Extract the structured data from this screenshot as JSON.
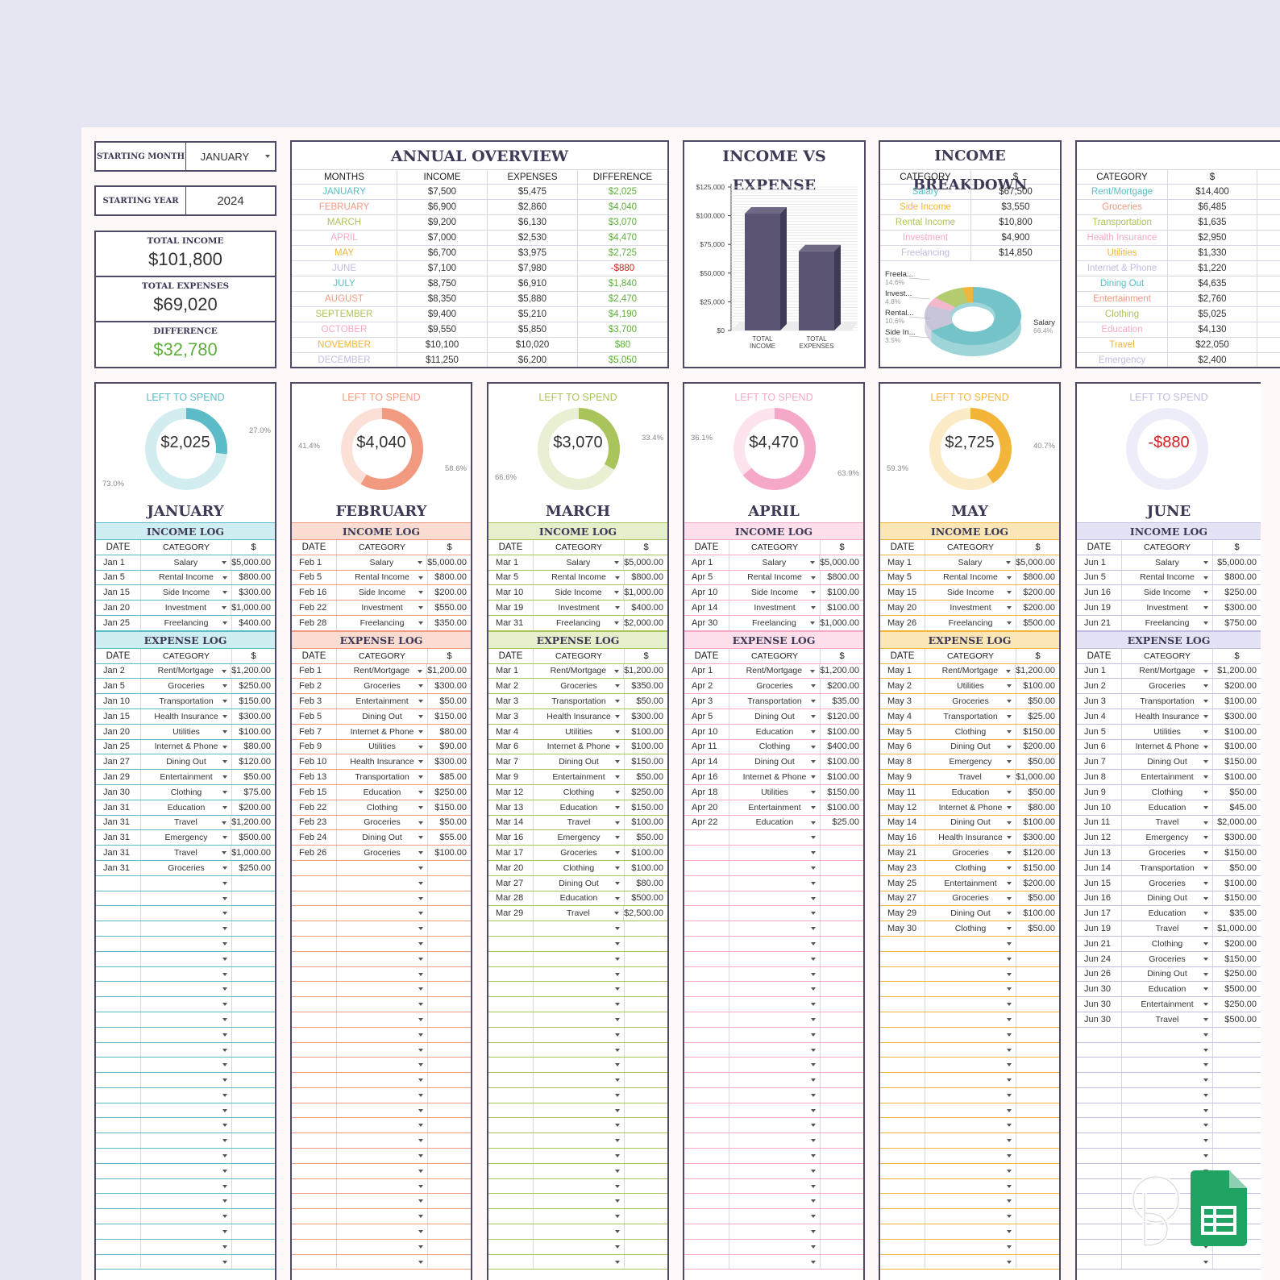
{
  "settings": {
    "starting_month_label": "STARTING MONTH",
    "starting_month_value": "JANUARY",
    "starting_year_label": "STARTING YEAR",
    "starting_year_value": "2024"
  },
  "totals": {
    "income_label": "TOTAL INCOME",
    "income": "$101,800",
    "expenses_label": "TOTAL EXPENSES",
    "expenses": "$69,020",
    "difference_label": "DIFFERENCE",
    "difference": "$32,780"
  },
  "overview": {
    "title": "ANNUAL OVERVIEW",
    "headers": [
      "MONTHS",
      "INCOME",
      "EXPENSES",
      "DIFFERENCE"
    ],
    "rows": [
      {
        "month": "JANUARY",
        "income": "$7,500",
        "expenses": "$5,475",
        "diff": "$2,025",
        "color": "#5bbcc7",
        "neg": false
      },
      {
        "month": "FEBRUARY",
        "income": "$6,900",
        "expenses": "$2,860",
        "diff": "$4,040",
        "color": "#f29a80",
        "neg": false
      },
      {
        "month": "MARCH",
        "income": "$9,200",
        "expenses": "$6,130",
        "diff": "$3,070",
        "color": "#a9c45b",
        "neg": false
      },
      {
        "month": "APRIL",
        "income": "$7,000",
        "expenses": "$2,530",
        "diff": "$4,470",
        "color": "#f5a8c8",
        "neg": false
      },
      {
        "month": "MAY",
        "income": "$6,700",
        "expenses": "$3,975",
        "diff": "$2,725",
        "color": "#f2b53a",
        "neg": false
      },
      {
        "month": "JUNE",
        "income": "$7,100",
        "expenses": "$7,980",
        "diff": "-$880",
        "color": "#c0bde0",
        "neg": true
      },
      {
        "month": "JULY",
        "income": "$8,750",
        "expenses": "$6,910",
        "diff": "$1,840",
        "color": "#5bbcc7",
        "neg": false
      },
      {
        "month": "AUGUST",
        "income": "$8,350",
        "expenses": "$5,880",
        "diff": "$2,470",
        "color": "#f29a80",
        "neg": false
      },
      {
        "month": "SEPTEMBER",
        "income": "$9,400",
        "expenses": "$5,210",
        "diff": "$4,190",
        "color": "#a9c45b",
        "neg": false
      },
      {
        "month": "OCTOBER",
        "income": "$9,550",
        "expenses": "$5,850",
        "diff": "$3,700",
        "color": "#f5a8c8",
        "neg": false
      },
      {
        "month": "NOVEMBER",
        "income": "$10,100",
        "expenses": "$10,020",
        "diff": "$80",
        "color": "#f2b53a",
        "neg": false
      },
      {
        "month": "DECEMBER",
        "income": "$11,250",
        "expenses": "$6,200",
        "diff": "$5,050",
        "color": "#c0bde0",
        "neg": false
      }
    ]
  },
  "chart_data": [
    {
      "type": "bar",
      "title": "INCOME VS EXPENSE",
      "categories": [
        "TOTAL INCOME",
        "TOTAL EXPENSES"
      ],
      "values": [
        101800,
        69020
      ],
      "ylim": [
        0,
        125000
      ],
      "yticks": [
        "$0",
        "$25,000",
        "$50,000",
        "$75,000",
        "$100,000",
        "$125,000"
      ],
      "ytick_values": [
        0,
        25000,
        50000,
        75000,
        100000,
        125000
      ],
      "bar_color": "#5a5472",
      "grid": true
    },
    {
      "type": "pie",
      "title": "INCOME BREAKDOWN",
      "slices": [
        {
          "label": "Salary",
          "value": 66.4,
          "color": "#74c3c9",
          "text": "Salary",
          "pct": "66.4%"
        },
        {
          "label": "Freelancing",
          "value": 14.6,
          "color": "#c8c4d9",
          "text": "Freela...",
          "pct": "14.6%"
        },
        {
          "label": "Investment",
          "value": 4.8,
          "color": "#f4b6cd",
          "text": "Invest...",
          "pct": "4.8%"
        },
        {
          "label": "Rental Income",
          "value": 10.6,
          "color": "#b3cc70",
          "text": "Rental...",
          "pct": "10.6%"
        },
        {
          "label": "Side Income",
          "value": 3.5,
          "color": "#f2b53a",
          "text": "Side In...",
          "pct": "3.5%"
        }
      ]
    }
  ],
  "income_breakdown": {
    "headers": [
      "CATEGORY",
      "$"
    ],
    "rows": [
      {
        "cat": "Salary",
        "val": "$67,500",
        "color": "#5bbcc7"
      },
      {
        "cat": "Side Income",
        "val": "$3,550",
        "color": "#f2b53a"
      },
      {
        "cat": "Rental Income",
        "val": "$10,800",
        "color": "#a9c45b"
      },
      {
        "cat": "Investment",
        "val": "$4,900",
        "color": "#f5a8c8"
      },
      {
        "cat": "Freelancing",
        "val": "$14,850",
        "color": "#c0bde0"
      }
    ]
  },
  "expense_breakdown": {
    "headers": [
      "CATEGORY",
      "$"
    ],
    "rows": [
      {
        "cat": "Rent/Mortgage",
        "val": "$14,400",
        "color": "#5bbcc7"
      },
      {
        "cat": "Groceries",
        "val": "$6,485",
        "color": "#f29a80"
      },
      {
        "cat": "Transportation",
        "val": "$1,635",
        "color": "#a9c45b"
      },
      {
        "cat": "Health Insurance",
        "val": "$2,950",
        "color": "#f5a8c8"
      },
      {
        "cat": "Utilities",
        "val": "$1,330",
        "color": "#f2b53a"
      },
      {
        "cat": "Internet & Phone",
        "val": "$1,220",
        "color": "#c0bde0"
      },
      {
        "cat": "Dining Out",
        "val": "$4,635",
        "color": "#5bbcc7"
      },
      {
        "cat": "Entertainment",
        "val": "$2,760",
        "color": "#f29a80"
      },
      {
        "cat": "Clothing",
        "val": "$5,025",
        "color": "#a9c45b"
      },
      {
        "cat": "Education",
        "val": "$4,130",
        "color": "#f5a8c8"
      },
      {
        "cat": "Travel",
        "val": "$22,050",
        "color": "#f2b53a"
      },
      {
        "cat": "Emergency",
        "val": "$2,400",
        "color": "#c0bde0"
      }
    ]
  },
  "labels": {
    "left_to_spend": "LEFT TO SPEND",
    "income_log": "INCOME LOG",
    "expense_log": "EXPENSE LOG",
    "date": "DATE",
    "category": "CATEGORY",
    "dollar": "$"
  },
  "months": [
    {
      "name": "JANUARY",
      "left": "$2,025",
      "color": "#5bbcc7",
      "light": "#d2edf0",
      "bg": "#cfeef1",
      "ring": "#5bbcc7",
      "spent_frac": 0.73,
      "pct_small": "27.0%",
      "pct_large": "73.0%",
      "neg": false,
      "income": [
        [
          "Jan 1",
          "Salary",
          "$5,000.00"
        ],
        [
          "Jan 5",
          "Rental Income",
          "$800.00"
        ],
        [
          "Jan 15",
          "Side Income",
          "$300.00"
        ],
        [
          "Jan 20",
          "Investment",
          "$1,000.00"
        ],
        [
          "Jan 25",
          "Freelancing",
          "$400.00"
        ]
      ],
      "expenses": [
        [
          "Jan 2",
          "Rent/Mortgage",
          "$1,200.00"
        ],
        [
          "Jan 5",
          "Groceries",
          "$250.00"
        ],
        [
          "Jan 10",
          "Transportation",
          "$150.00"
        ],
        [
          "Jan 15",
          "Health Insurance",
          "$300.00"
        ],
        [
          "Jan 20",
          "Utilities",
          "$100.00"
        ],
        [
          "Jan 25",
          "Internet & Phone",
          "$80.00"
        ],
        [
          "Jan 27",
          "Dining Out",
          "$120.00"
        ],
        [
          "Jan 29",
          "Entertainment",
          "$50.00"
        ],
        [
          "Jan 30",
          "Clothing",
          "$75.00"
        ],
        [
          "Jan 31",
          "Education",
          "$200.00"
        ],
        [
          "Jan 31",
          "Travel",
          "$1,200.00"
        ],
        [
          "Jan 31",
          "Emergency",
          "$500.00"
        ],
        [
          "Jan 31",
          "Travel",
          "$1,000.00"
        ],
        [
          "Jan 31",
          "Groceries",
          "$250.00"
        ]
      ]
    },
    {
      "name": "FEBRUARY",
      "left": "$4,040",
      "color": "#f29a80",
      "light": "#fbe0d8",
      "bg": "#fbdcd3",
      "ring": "#f29a80",
      "spent_frac": 0.414,
      "pct_small": "41.4%",
      "pct_large": "58.6%",
      "neg": false,
      "income": [
        [
          "Feb 1",
          "Salary",
          "$5,000.00"
        ],
        [
          "Feb 5",
          "Rental Income",
          "$800.00"
        ],
        [
          "Feb 16",
          "Side Income",
          "$200.00"
        ],
        [
          "Feb 22",
          "Investment",
          "$550.00"
        ],
        [
          "Feb 28",
          "Freelancing",
          "$350.00"
        ]
      ],
      "expenses": [
        [
          "Feb 1",
          "Rent/Mortgage",
          "$1,200.00"
        ],
        [
          "Feb 2",
          "Groceries",
          "$300.00"
        ],
        [
          "Feb 3",
          "Entertainment",
          "$50.00"
        ],
        [
          "Feb 5",
          "Dining Out",
          "$150.00"
        ],
        [
          "Feb 7",
          "Internet & Phone",
          "$80.00"
        ],
        [
          "Feb 9",
          "Utilities",
          "$90.00"
        ],
        [
          "Feb 10",
          "Health Insurance",
          "$300.00"
        ],
        [
          "Feb 13",
          "Transportation",
          "$85.00"
        ],
        [
          "Feb 15",
          "Education",
          "$250.00"
        ],
        [
          "Feb 22",
          "Clothing",
          "$150.00"
        ],
        [
          "Feb 23",
          "Groceries",
          "$50.00"
        ],
        [
          "Feb 24",
          "Dining Out",
          "$55.00"
        ],
        [
          "Feb 26",
          "Groceries",
          "$100.00"
        ]
      ]
    },
    {
      "name": "MARCH",
      "left": "$3,070",
      "color": "#a9c45b",
      "light": "#e8efd2",
      "bg": "#e5efcb",
      "ring": "#a9c45b",
      "spent_frac": 0.666,
      "pct_small": "33.4%",
      "pct_large": "66.6%",
      "neg": false,
      "income": [
        [
          "Mar 1",
          "Salary",
          "$5,000.00"
        ],
        [
          "Mar 5",
          "Rental Income",
          "$800.00"
        ],
        [
          "Mar 10",
          "Side Income",
          "$1,000.00"
        ],
        [
          "Mar 19",
          "Investment",
          "$400.00"
        ],
        [
          "Mar 31",
          "Freelancing",
          "$2,000.00"
        ]
      ],
      "expenses": [
        [
          "Mar 1",
          "Rent/Mortgage",
          "$1,200.00"
        ],
        [
          "Mar 2",
          "Groceries",
          "$350.00"
        ],
        [
          "Mar 3",
          "Transportation",
          "$50.00"
        ],
        [
          "Mar 3",
          "Health Insurance",
          "$300.00"
        ],
        [
          "Mar 4",
          "Utilities",
          "$100.00"
        ],
        [
          "Mar 6",
          "Internet & Phone",
          "$100.00"
        ],
        [
          "Mar 7",
          "Dining Out",
          "$150.00"
        ],
        [
          "Mar 9",
          "Entertainment",
          "$50.00"
        ],
        [
          "Mar 12",
          "Clothing",
          "$250.00"
        ],
        [
          "Mar 13",
          "Education",
          "$150.00"
        ],
        [
          "Mar 14",
          "Travel",
          "$100.00"
        ],
        [
          "Mar 16",
          "Emergency",
          "$50.00"
        ],
        [
          "Mar 17",
          "Groceries",
          "$100.00"
        ],
        [
          "Mar 20",
          "Clothing",
          "$100.00"
        ],
        [
          "Mar 27",
          "Dining Out",
          "$80.00"
        ],
        [
          "Mar 28",
          "Education",
          "$500.00"
        ],
        [
          "Mar 29",
          "Travel",
          "$2,500.00"
        ]
      ]
    },
    {
      "name": "APRIL",
      "left": "$4,470",
      "color": "#f5a8c8",
      "light": "#fde3ee",
      "bg": "#fcdfea",
      "ring": "#f5a8c8",
      "spent_frac": 0.361,
      "pct_small": "36.1%",
      "pct_large": "63.9%",
      "neg": false,
      "income": [
        [
          "Apr 1",
          "Salary",
          "$5,000.00"
        ],
        [
          "Apr 5",
          "Rental Income",
          "$800.00"
        ],
        [
          "Apr 10",
          "Side Income",
          "$100.00"
        ],
        [
          "Apr 14",
          "Investment",
          "$100.00"
        ],
        [
          "Apr 30",
          "Freelancing",
          "$1,000.00"
        ]
      ],
      "expenses": [
        [
          "Apr 1",
          "Rent/Mortgage",
          "$1,200.00"
        ],
        [
          "Apr 2",
          "Groceries",
          "$200.00"
        ],
        [
          "Apr 3",
          "Transportation",
          "$35.00"
        ],
        [
          "Apr 5",
          "Dining Out",
          "$120.00"
        ],
        [
          "Apr 10",
          "Education",
          "$100.00"
        ],
        [
          "Apr 11",
          "Clothing",
          "$400.00"
        ],
        [
          "Apr 14",
          "Dining Out",
          "$100.00"
        ],
        [
          "Apr 16",
          "Internet & Phone",
          "$100.00"
        ],
        [
          "Apr 18",
          "Utilities",
          "$150.00"
        ],
        [
          "Apr 20",
          "Entertainment",
          "$100.00"
        ],
        [
          "Apr 22",
          "Education",
          "$25.00"
        ]
      ]
    },
    {
      "name": "MAY",
      "left": "$2,725",
      "color": "#f2b53a",
      "light": "#fcebc7",
      "bg": "#fbe6b8",
      "ring": "#f2b53a",
      "spent_frac": 0.593,
      "pct_small": "40.7%",
      "pct_large": "59.3%",
      "neg": false,
      "income": [
        [
          "May 1",
          "Salary",
          "$5,000.00"
        ],
        [
          "May 5",
          "Rental Income",
          "$800.00"
        ],
        [
          "May 15",
          "Side Income",
          "$200.00"
        ],
        [
          "May 20",
          "Investment",
          "$200.00"
        ],
        [
          "May 26",
          "Freelancing",
          "$500.00"
        ]
      ],
      "expenses": [
        [
          "May 1",
          "Rent/Mortgage",
          "$1,200.00"
        ],
        [
          "May 2",
          "Utilities",
          "$100.00"
        ],
        [
          "May 3",
          "Groceries",
          "$50.00"
        ],
        [
          "May 4",
          "Transportation",
          "$25.00"
        ],
        [
          "May 5",
          "Clothing",
          "$150.00"
        ],
        [
          "May 6",
          "Dining Out",
          "$200.00"
        ],
        [
          "May 8",
          "Emergency",
          "$50.00"
        ],
        [
          "May 9",
          "Travel",
          "$1,000.00"
        ],
        [
          "May 11",
          "Education",
          "$50.00"
        ],
        [
          "May 12",
          "Internet & Phone",
          "$80.00"
        ],
        [
          "May 14",
          "Dining Out",
          "$100.00"
        ],
        [
          "May 16",
          "Health Insurance",
          "$300.00"
        ],
        [
          "May 21",
          "Groceries",
          "$120.00"
        ],
        [
          "May 23",
          "Clothing",
          "$150.00"
        ],
        [
          "May 25",
          "Entertainment",
          "$200.00"
        ],
        [
          "May 27",
          "Groceries",
          "$50.00"
        ],
        [
          "May 29",
          "Dining Out",
          "$100.00"
        ],
        [
          "May 30",
          "Clothing",
          "$50.00"
        ]
      ]
    },
    {
      "name": "JUNE",
      "left": "-$880",
      "color": "#c0bde0",
      "light": "#ededf9",
      "bg": "#e4e3f6",
      "ring": "#c0bde0",
      "spent_frac": 1.0,
      "pct_small": "",
      "pct_large": "",
      "neg": true,
      "income": [
        [
          "Jun 1",
          "Salary",
          "$5,000.00"
        ],
        [
          "Jun 5",
          "Rental Income",
          "$800.00"
        ],
        [
          "Jun 16",
          "Side Income",
          "$250.00"
        ],
        [
          "Jun 19",
          "Investment",
          "$300.00"
        ],
        [
          "Jun 21",
          "Freelancing",
          "$750.00"
        ]
      ],
      "expenses": [
        [
          "Jun 1",
          "Rent/Mortgage",
          "$1,200.00"
        ],
        [
          "Jun 2",
          "Groceries",
          "$200.00"
        ],
        [
          "Jun 3",
          "Transportation",
          "$100.00"
        ],
        [
          "Jun 4",
          "Health Insurance",
          "$300.00"
        ],
        [
          "Jun 5",
          "Utilities",
          "$100.00"
        ],
        [
          "Jun 6",
          "Internet & Phone",
          "$100.00"
        ],
        [
          "Jun 7",
          "Dining Out",
          "$150.00"
        ],
        [
          "Jun 8",
          "Entertainment",
          "$100.00"
        ],
        [
          "Jun 9",
          "Clothing",
          "$50.00"
        ],
        [
          "Jun 10",
          "Education",
          "$45.00"
        ],
        [
          "Jun 11",
          "Travel",
          "$2,000.00"
        ],
        [
          "Jun 12",
          "Emergency",
          "$300.00"
        ],
        [
          "Jun 13",
          "Groceries",
          "$150.00"
        ],
        [
          "Jun 14",
          "Transportation",
          "$50.00"
        ],
        [
          "Jun 15",
          "Groceries",
          "$100.00"
        ],
        [
          "Jun 16",
          "Dining Out",
          "$150.00"
        ],
        [
          "Jun 17",
          "Education",
          "$35.00"
        ],
        [
          "Jun 19",
          "Travel",
          "$1,000.00"
        ],
        [
          "Jun 21",
          "Clothing",
          "$200.00"
        ],
        [
          "Jun 24",
          "Groceries",
          "$150.00"
        ],
        [
          "Jun 26",
          "Dining Out",
          "$250.00"
        ],
        [
          "Jun 30",
          "Education",
          "$500.00"
        ],
        [
          "Jun 30",
          "Entertainment",
          "$250.00"
        ],
        [
          "Jun 30",
          "Travel",
          "$500.00"
        ]
      ]
    }
  ],
  "icons": {
    "sheets": "google-sheets-icon",
    "logo": "brand-monogram-logo"
  }
}
